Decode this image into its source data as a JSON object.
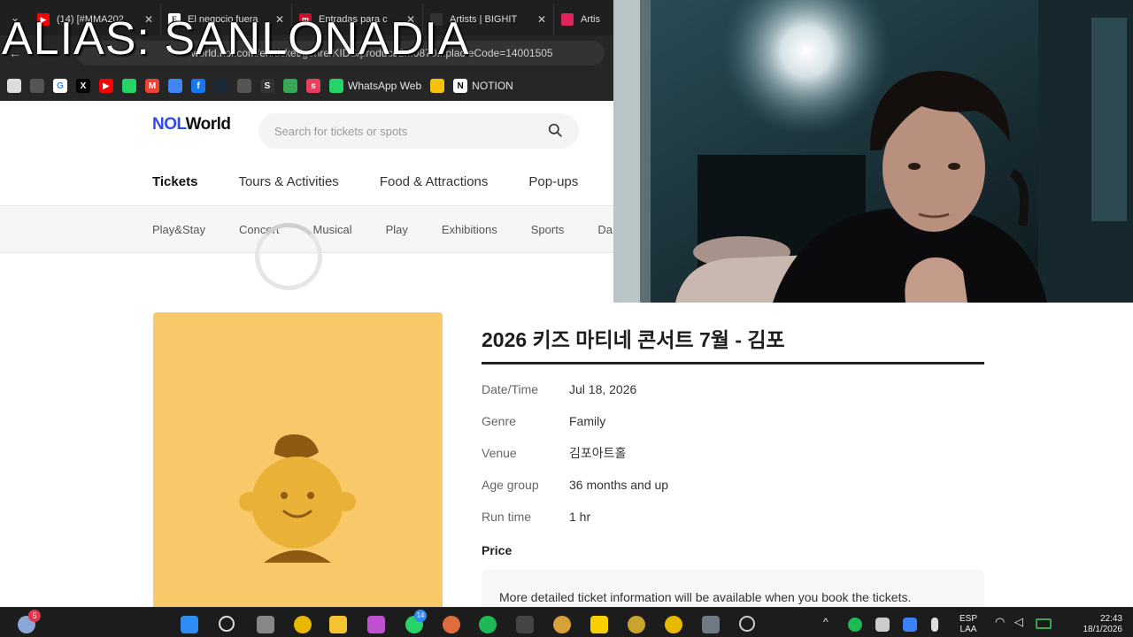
{
  "overlay": {
    "alias_text": "ALIAS: SANLONADIA"
  },
  "browser": {
    "tabs": [
      {
        "label": "(14) [#MMA202",
        "favicon_color": "#ff0000"
      },
      {
        "label": "El negocio fuera",
        "favicon_color": "#ffffff"
      },
      {
        "label": "Entradas para c",
        "favicon_color": "#c8102e"
      },
      {
        "label": "Artists | BIGHIT",
        "favicon_color": "#333333"
      },
      {
        "label": "Artis",
        "favicon_color": "#e0245e"
      }
    ],
    "url": "world.nol.com/en/ticket/genre/KIDS/product/2...0870...plac eCode=14001505",
    "bookmarks": [
      {
        "label": "WhatsApp Web"
      },
      {
        "label": "NOTION"
      }
    ]
  },
  "site": {
    "logo_nol": "NOL",
    "logo_world": "World",
    "search_placeholder": "Search for tickets or spots",
    "nav": [
      "Tickets",
      "Tours & Activities",
      "Food & Attractions",
      "Pop-ups"
    ],
    "subnav": [
      "Play&Stay",
      "Concert",
      "Musical",
      "Play",
      "Exhibitions",
      "Sports",
      "Da"
    ]
  },
  "event": {
    "title": "2026 키즈 마티네 콘서트 7월 - 김포",
    "details": [
      {
        "key": "Date/Time",
        "value": "Jul 18, 2026"
      },
      {
        "key": "Genre",
        "value": "Family"
      },
      {
        "key": "Venue",
        "value": "김포아트홀"
      },
      {
        "key": "Age group",
        "value": "36 months and up"
      },
      {
        "key": "Run time",
        "value": "1 hr"
      }
    ],
    "price_label": "Price",
    "price_note": "More detailed ticket information will be available when you book the tickets."
  },
  "taskbar": {
    "weather_badge": "5",
    "whatsapp_badge": "14",
    "language_top": "ESP",
    "language_bottom": "LAA",
    "time": "22:43",
    "date": "18/1/2026"
  },
  "colors": {
    "brand_blue": "#2f4bf0",
    "poster_yellow": "#f9c869",
    "character_yellow": "#e9b236",
    "character_brown": "#8d5a14"
  }
}
